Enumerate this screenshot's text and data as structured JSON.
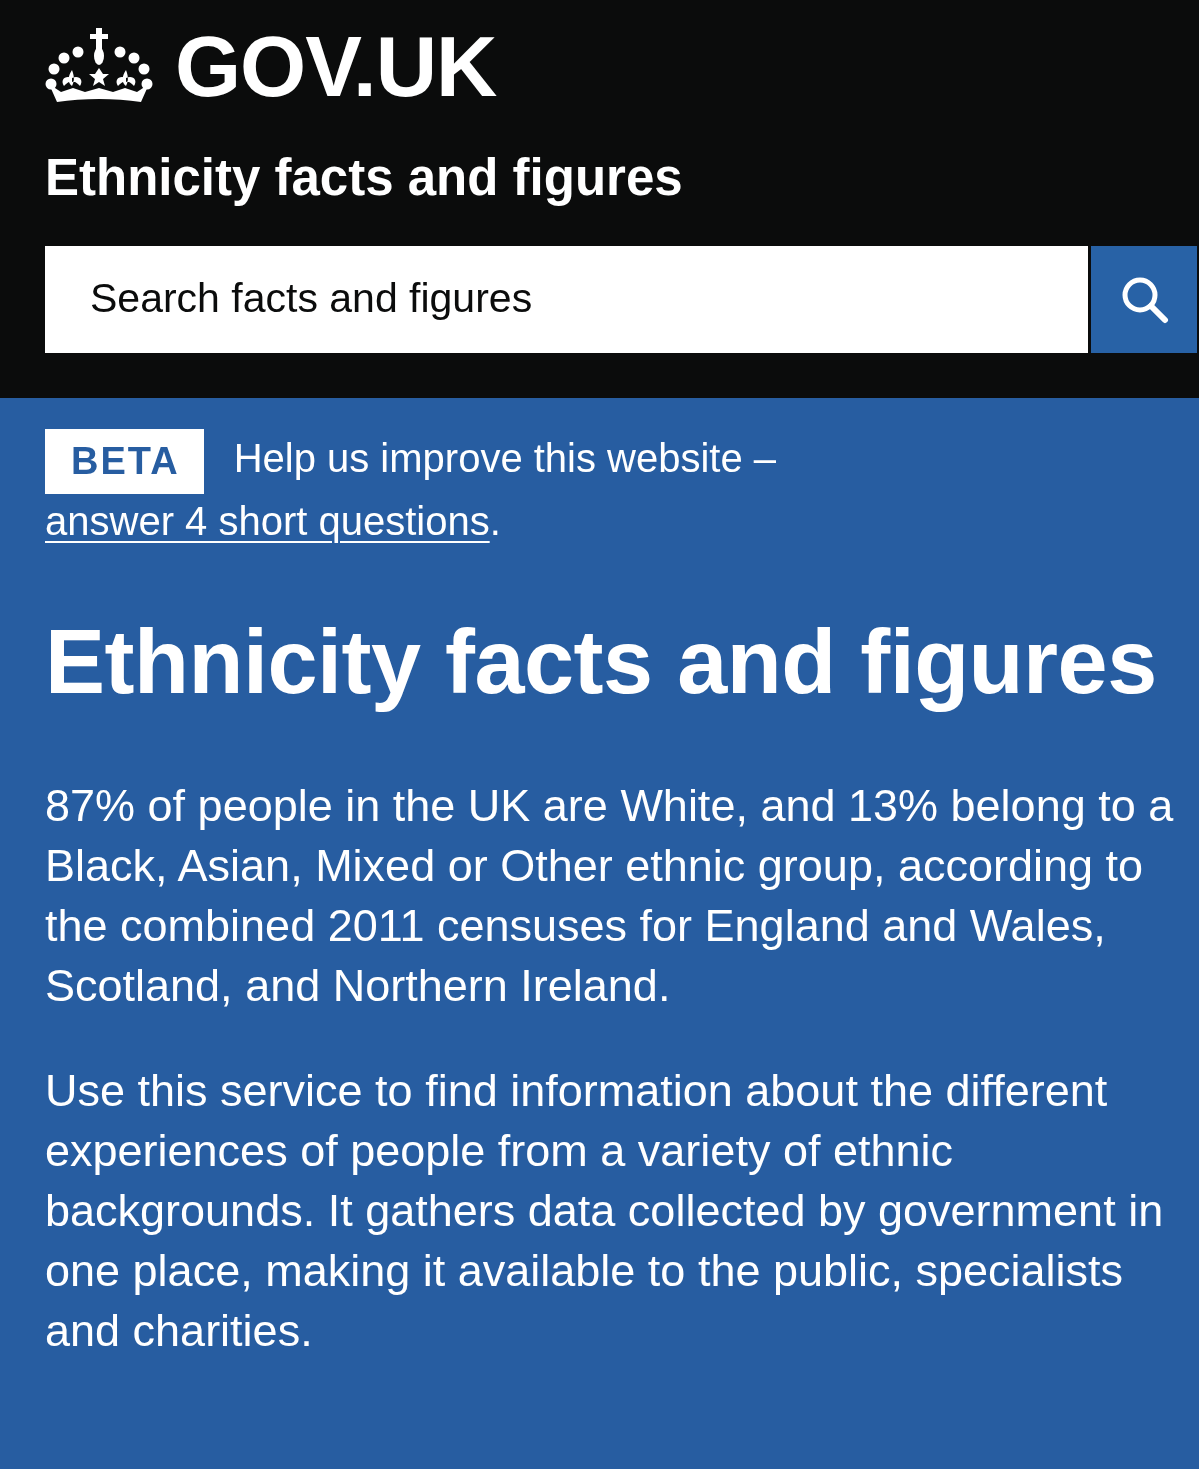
{
  "header": {
    "logo": {
      "text": "GOV.UK"
    },
    "service_name": "Ethnicity facts and figures",
    "search": {
      "placeholder": "Search facts and figures"
    }
  },
  "phase_banner": {
    "tag": "BETA",
    "text_before": "Help us improve this website – ",
    "link_text": "answer 4 short questions",
    "text_after": "."
  },
  "hero": {
    "title": "Ethnicity facts and figures",
    "paragraphs": [
      "87% of people in the UK are White, and 13% belong to a Black, Asian, Mixed or Other ethnic group, according to the combined 2011 censuses for England and Wales, Scotland, and Northern Ireland.",
      "Use this service to find information about the different experiences of people from a variety of ethnic backgrounds. It gathers data collected by government in one place, making it available to the public, specialists and charities."
    ]
  }
}
